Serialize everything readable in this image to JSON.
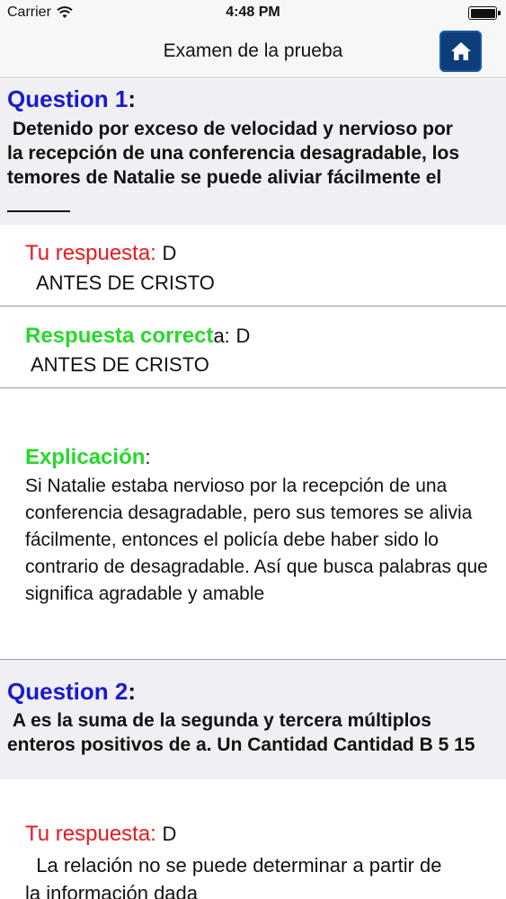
{
  "status": {
    "carrier": "Carrier",
    "time": "4:48 PM"
  },
  "nav": {
    "title": "Examen de la prueba",
    "home_icon": "home-icon"
  },
  "questions": [
    {
      "title": "Question 1",
      "colon": ":",
      "text": " Detenido por exceso de velocidad y nervioso por\nla recepción de una conferencia desagradable, los\ntemores de Natalie se puede aliviar fácilmente el",
      "your_label": "Tu respuesta:",
      "your_value": "D",
      "your_text": "ANTES DE CRISTO",
      "correct_label": "Respuesta correct",
      "correct_suffix": "a:",
      "correct_value": "D",
      "correct_text": "ANTES DE CRISTO",
      "expl_label": "Explicación",
      "expl_colon": ":",
      "expl_text": " Si Natalie estaba nervioso por la recepción de una conferencia desagradable, pero sus temores se alivia fácilmente, entonces el policía debe haber sido lo contrario de desagradable. Así que busca palabras que significa agradable y amable"
    },
    {
      "title": "Question 2",
      "colon": ":",
      "text": " A es la suma de la segunda y tercera múltiplos\nenteros positivos de a. Un Cantidad Cantidad B 5 15",
      "your_label": "Tu respuesta:",
      "your_value": "D",
      "your_text": "  La relación no se puede determinar a partir de\nla información dada"
    }
  ],
  "colors": {
    "question_title": "#1a1acc",
    "your_label": "#e8191e",
    "correct_label": "#27d82b",
    "home_button": "#0d3d7a"
  }
}
